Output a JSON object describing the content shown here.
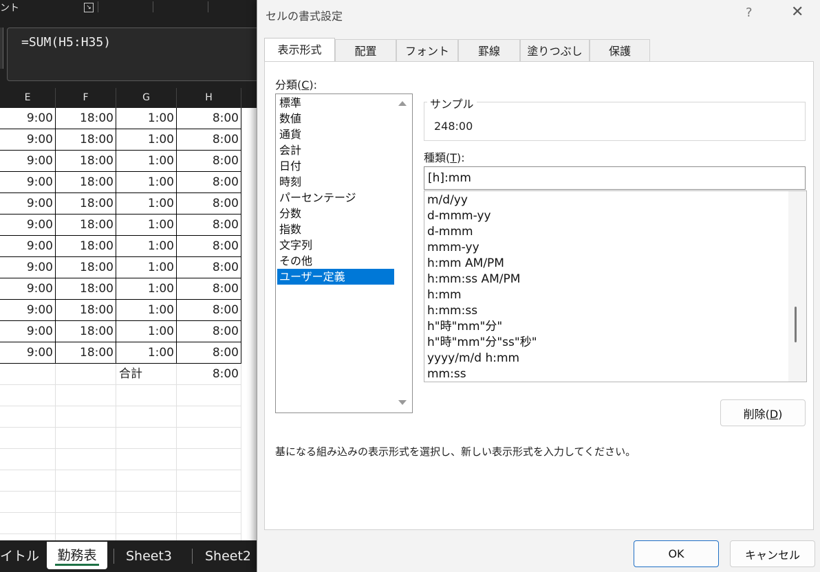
{
  "excel": {
    "ribbon_label": "ント",
    "formula": "=SUM(H5:H35)",
    "columns": [
      "E",
      "F",
      "G",
      "H"
    ],
    "rows": [
      [
        "9:00",
        "18:00",
        "1:00",
        "8:00"
      ],
      [
        "9:00",
        "18:00",
        "1:00",
        "8:00"
      ],
      [
        "9:00",
        "18:00",
        "1:00",
        "8:00"
      ],
      [
        "9:00",
        "18:00",
        "1:00",
        "8:00"
      ],
      [
        "9:00",
        "18:00",
        "1:00",
        "8:00"
      ],
      [
        "9:00",
        "18:00",
        "1:00",
        "8:00"
      ],
      [
        "9:00",
        "18:00",
        "1:00",
        "8:00"
      ],
      [
        "9:00",
        "18:00",
        "1:00",
        "8:00"
      ],
      [
        "9:00",
        "18:00",
        "1:00",
        "8:00"
      ],
      [
        "9:00",
        "18:00",
        "1:00",
        "8:00"
      ],
      [
        "9:00",
        "18:00",
        "1:00",
        "8:00"
      ],
      [
        "9:00",
        "18:00",
        "1:00",
        "8:00"
      ]
    ],
    "total_label": "合計",
    "total_value": "8:00",
    "sheet_tabs": [
      "イトル",
      "勤務表",
      "Sheet3",
      "Sheet2"
    ],
    "active_sheet": "勤務表"
  },
  "dialog": {
    "title": "セルの書式設定",
    "help": "?",
    "close": "✕",
    "tabs": [
      "表示形式",
      "配置",
      "フォント",
      "罫線",
      "塗りつぶし",
      "保護"
    ],
    "active_tab": "表示形式",
    "category_label_pre": "分類(",
    "category_label_key": "C",
    "category_label_post": "):",
    "categories": [
      "標準",
      "数値",
      "通貨",
      "会計",
      "日付",
      "時刻",
      "パーセンテージ",
      "分数",
      "指数",
      "文字列",
      "その他",
      "ユーザー定義"
    ],
    "selected_category": "ユーザー定義",
    "sample_label": "サンプル",
    "sample_value": "248:00",
    "type_label_pre": "種類(",
    "type_label_key": "T",
    "type_label_post": "):",
    "type_value": "[h]:mm",
    "format_list": [
      "m/d/yy",
      "d-mmm-yy",
      "d-mmm",
      "mmm-yy",
      "h:mm AM/PM",
      "h:mm:ss AM/PM",
      "h:mm",
      "h:mm:ss",
      "h\"時\"mm\"分\"",
      "h\"時\"mm\"分\"ss\"秒\"",
      "yyyy/m/d h:mm",
      "mm:ss"
    ],
    "delete_pre": "削除(",
    "delete_key": "D",
    "delete_post": ")",
    "description": "基になる組み込みの表示形式を選択し、新しい表示形式を入力してください。",
    "ok_label": "OK",
    "cancel_label": "キャンセル"
  }
}
